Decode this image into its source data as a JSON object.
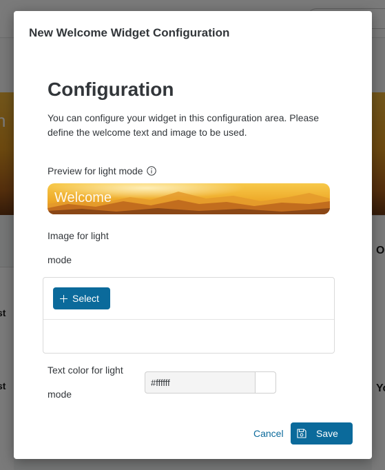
{
  "background": {
    "banner_text": "n",
    "row_texts": [
      "st",
      "st",
      "O",
      "Yo"
    ]
  },
  "dialog": {
    "title": "New Welcome Widget Configuration",
    "heading": "Configuration",
    "description": "You can configure your widget in this configuration area. Please define the welcome text and image to be used.",
    "preview_label": "Preview for light mode",
    "preview_text": "Welcome",
    "image_label_line1": "Image for light",
    "image_label_line2": "mode",
    "select_button": "Select",
    "text_color_label_line1": "Text color for light",
    "text_color_label_line2": "mode",
    "text_color_value": "#ffffff",
    "cancel_label": "Cancel",
    "save_label": "Save"
  },
  "colors": {
    "primary_button": "#0b6a9b",
    "overlay": "rgba(0,0,0,0.52)"
  },
  "icons": [
    "info-icon",
    "plus-icon",
    "save-icon"
  ]
}
